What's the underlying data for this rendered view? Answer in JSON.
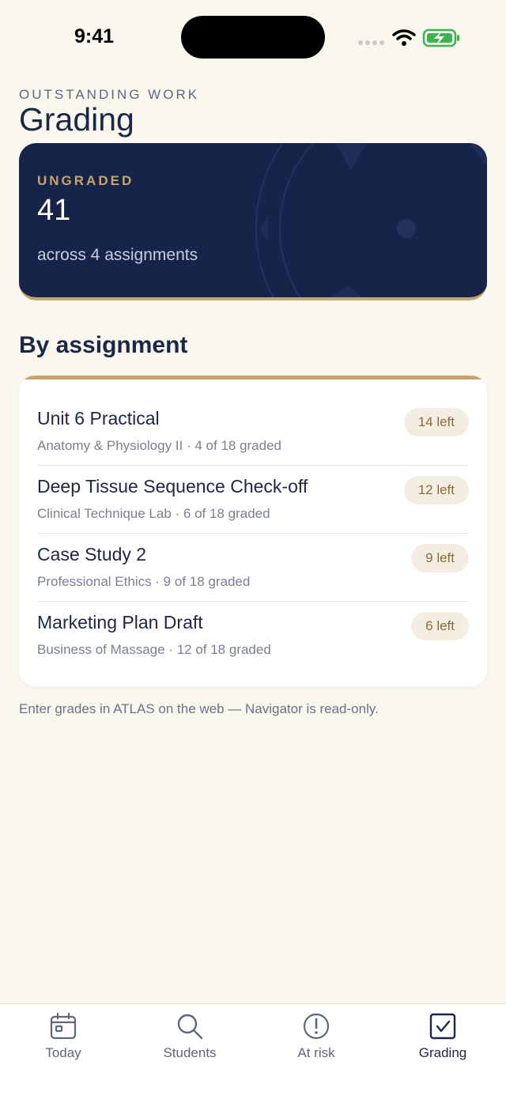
{
  "status": {
    "time": "9:41"
  },
  "header": {
    "eyebrow": "OUTSTANDING WORK",
    "title": "Grading"
  },
  "summary": {
    "label": "UNGRADED",
    "count": "41",
    "subtitle": "across 4 assignments"
  },
  "section": {
    "title": "By assignment"
  },
  "assignments": [
    {
      "title": "Unit 6 Practical",
      "meta": "Anatomy & Physiology II · 4 of 18 graded",
      "badge": "14 left"
    },
    {
      "title": "Deep Tissue Sequence Check-off",
      "meta": "Clinical Technique Lab · 6 of 18 graded",
      "badge": "12 left"
    },
    {
      "title": "Case Study 2",
      "meta": "Professional Ethics · 9 of 18 graded",
      "badge": "9 left"
    },
    {
      "title": "Marketing Plan Draft",
      "meta": "Business of Massage · 12 of 18 graded",
      "badge": "6 left"
    }
  ],
  "footnote": "Enter grades in ATLAS on the web — Navigator is read-only.",
  "tabs": [
    {
      "label": "Today",
      "icon": "calendar-icon"
    },
    {
      "label": "Students",
      "icon": "search-icon"
    },
    {
      "label": "At risk",
      "icon": "alert-circle-icon"
    },
    {
      "label": "Grading",
      "icon": "checkbox-icon",
      "active": true
    }
  ],
  "colors": {
    "background": "#FAF7EF",
    "navy": "#16244A",
    "gold": "#C6A46C",
    "pill_bg": "#F4EEE2"
  }
}
